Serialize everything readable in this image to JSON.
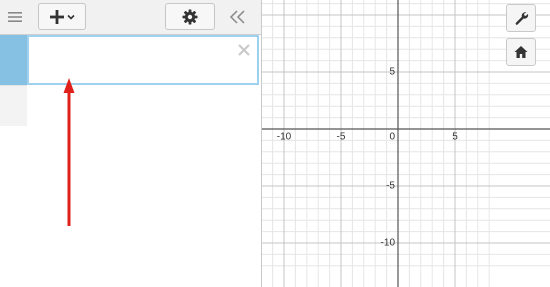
{
  "toolbar": {
    "menu_icon": "hamburger-menu-icon",
    "add_icon": "plus-icon",
    "add_dropdown_icon": "chevron-down-icon",
    "settings_icon": "gear-icon",
    "collapse_icon": "double-chevron-left-icon"
  },
  "expression_list": {
    "expressions": [
      {
        "value": "",
        "placeholder": ""
      }
    ],
    "delete_icon": "close-icon"
  },
  "graph": {
    "x_ticks": [
      "-10",
      "-5",
      "0",
      "5"
    ],
    "y_ticks": [
      "5",
      "-5",
      "-10"
    ],
    "x_range": [
      -11,
      8
    ],
    "y_range": [
      -12,
      11
    ],
    "grid": true
  },
  "side_controls": {
    "wrench_icon": "wrench-icon",
    "home_icon": "home-icon"
  },
  "annotation": {
    "arrow_color": "#e0201a"
  }
}
